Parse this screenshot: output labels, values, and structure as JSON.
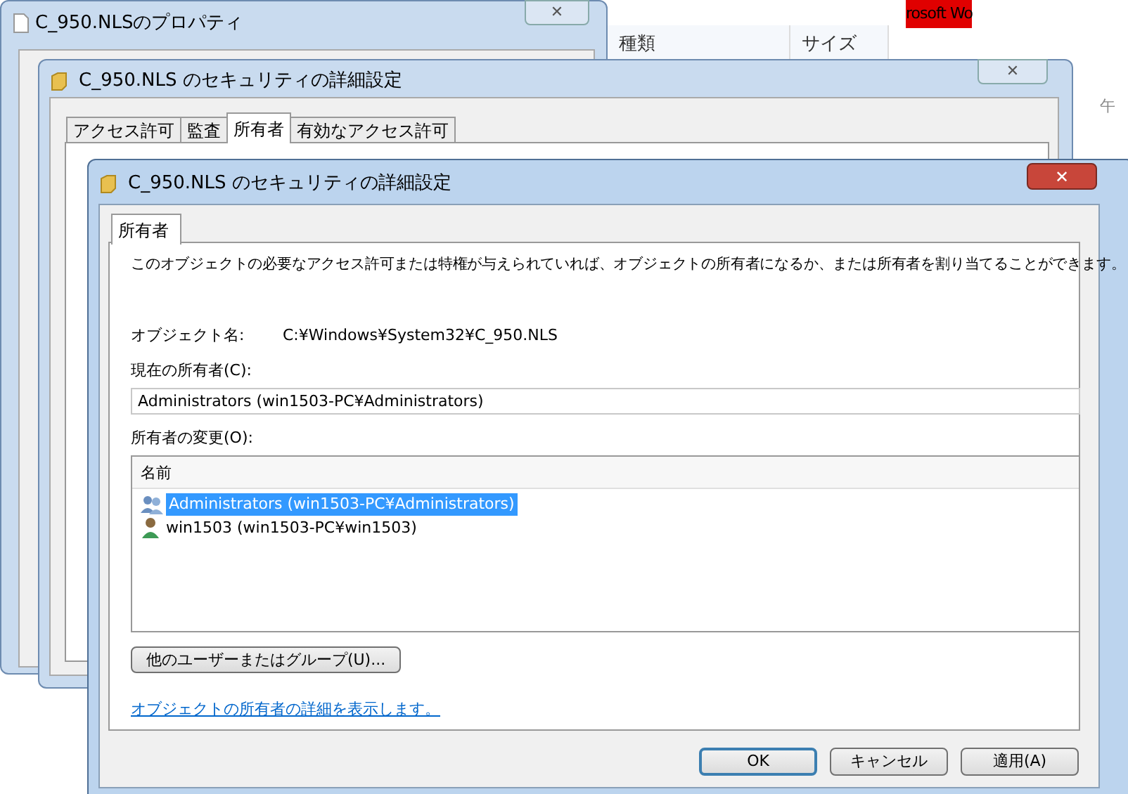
{
  "back_window": {
    "title": "C_950.NLSのプロパティ",
    "close": "✕"
  },
  "explorer": {
    "columns": [
      "種類",
      "サイズ"
    ],
    "banner": "rosoft Wo",
    "clock_fragment": "午"
  },
  "middle_window": {
    "title": "C_950.NLS のセキュリティの詳細設定",
    "close": "✕",
    "tabs": [
      {
        "label": "アクセス許可",
        "selected": false
      },
      {
        "label": "監査",
        "selected": false
      },
      {
        "label": "所有者",
        "selected": true
      },
      {
        "label": "有効なアクセス許可",
        "selected": false
      }
    ]
  },
  "window": {
    "title": "C_950.NLS のセキュリティの詳細設定",
    "close": "✕",
    "tabs": [
      {
        "label": "所有者",
        "selected": true
      }
    ],
    "description": "このオブジェクトの必要なアクセス許可または特権が与えられていれば、オブジェクトの所有者になるか、または所有者を割り当てることができます。",
    "object_name_label": "オブジェクト名:",
    "object_name": "C:¥Windows¥System32¥C_950.NLS",
    "current_owner_label": "現在の所有者(C):",
    "current_owner": "Administrators (win1503-PC¥Administrators)",
    "change_owner_label": "所有者の変更(O):",
    "list": {
      "column": "名前",
      "rows": [
        {
          "kind": "group",
          "label": "Administrators (win1503-PC¥Administrators)",
          "selected": true
        },
        {
          "kind": "user",
          "label": "win1503 (win1503-PC¥win1503)",
          "selected": false
        }
      ]
    },
    "other_users_button": "他のユーザーまたはグループ(U)...",
    "details_link": "オブジェクトの所有者の詳細を表示します。",
    "buttons": [
      {
        "label": "OK",
        "default": true
      },
      {
        "label": "キャンセル",
        "default": false
      },
      {
        "label": "適用(A)",
        "default": false
      }
    ]
  }
}
